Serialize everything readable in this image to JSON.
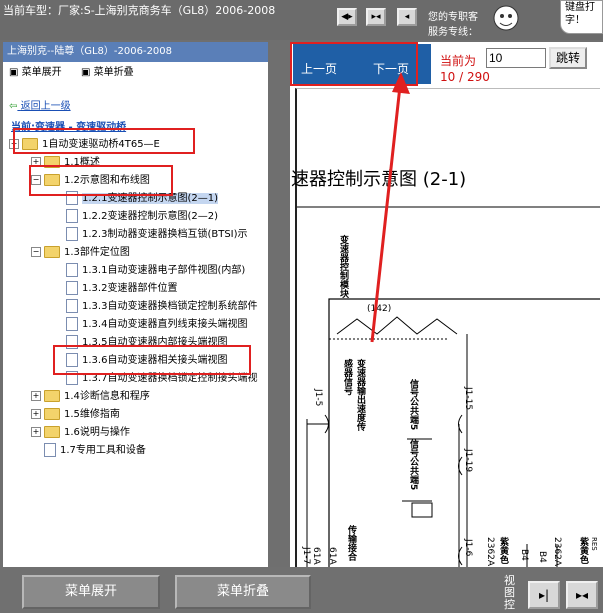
{
  "header": {
    "car_title": "当前车型：厂家:S-上海别克商务车（GL8）2006-2008",
    "help_line1": "您的专职客",
    "help_line2": "服务专线：",
    "bubble_line1": "键盘打",
    "bubble_line2": "字！",
    "nav_icons": [
      "prev-icon",
      "expand-icon",
      "next-icon"
    ]
  },
  "left": {
    "panel_title": "上海别克--陆尊（GL8）-2006-2008",
    "expand_label": "菜单展开",
    "collapse_label": "菜单折叠",
    "back_label": "返回上一级",
    "current_label": "当前:变速器 - 变速驱动桥",
    "tree": [
      {
        "label": "1自动变速驱动桥4T65—E",
        "level": 0,
        "type": "folder",
        "toggle": "−"
      },
      {
        "label": "1.1概述",
        "level": 1,
        "type": "folder",
        "toggle": "+"
      },
      {
        "label": "1.2示意图和布线图",
        "level": 1,
        "type": "folder",
        "toggle": "−"
      },
      {
        "label": "1.2.1变速器控制示意图(2—1)",
        "level": 2,
        "type": "doc",
        "selected": true
      },
      {
        "label": "1.2.2变速器控制示意图(2—2)",
        "level": 2,
        "type": "doc"
      },
      {
        "label": "1.2.3制动器变速器换档互锁(BTSI)示",
        "level": 2,
        "type": "doc"
      },
      {
        "label": "1.3部件定位图",
        "level": 1,
        "type": "folder",
        "toggle": "−"
      },
      {
        "label": "1.3.1自动变速器电子部件视图(内部)",
        "level": 2,
        "type": "doc"
      },
      {
        "label": "1.3.2变速器部件位置",
        "level": 2,
        "type": "doc"
      },
      {
        "label": "1.3.3自动变速器换档锁定控制系统部件",
        "level": 2,
        "type": "doc"
      },
      {
        "label": "1.3.4自动变速器直列线束接头端视图",
        "level": 2,
        "type": "doc"
      },
      {
        "label": "1.3.5自动变速器内部接头端视图",
        "level": 2,
        "type": "doc"
      },
      {
        "label": "1.3.6自动变速器相关接头端视图",
        "level": 2,
        "type": "doc"
      },
      {
        "label": "1.3.7自动变速器换档锁定控制接头端视",
        "level": 2,
        "type": "doc"
      },
      {
        "label": "1.4诊断信息和程序",
        "level": 1,
        "type": "folder",
        "toggle": "+"
      },
      {
        "label": "1.5维修指南",
        "level": 1,
        "type": "folder",
        "toggle": "+"
      },
      {
        "label": "1.6说明与操作",
        "level": 1,
        "type": "folder",
        "toggle": "+"
      },
      {
        "label": "1.7专用工具和设备",
        "level": 1,
        "type": "doc"
      }
    ]
  },
  "right": {
    "prev_page": "上一页",
    "next_page": "下一页",
    "current_label": "当前为",
    "page_input": "10",
    "page_status": "10 / 290",
    "goto_button": "跳转",
    "doc_title": "速器控制示意图  (2-1)",
    "schematic": {
      "top_label": "变速器控制模块",
      "top_code": "(142)",
      "mid_label": "变速器输出速度传感器信号",
      "sig1": "信号公共端5",
      "sig2": "信号公共端5",
      "c1": "J1-5",
      "c2": "J1-15",
      "c3": "J1-19",
      "c4": "J1-6",
      "c5": "J1-7",
      "w1": "2362A",
      "w2": "2362A",
      "w3": "紫黄色",
      "w4": "紫黄色",
      "b4": "B4",
      "b4b": "B4",
      "side1": "传输接合",
      "side2": "61A",
      "side3": "61A",
      "res": "RES"
    }
  },
  "bottom": {
    "expand_button": "菜单展开",
    "collapse_button": "菜单折叠",
    "view_label1": "视",
    "view_label2": "图",
    "view_label3": "控"
  },
  "colors": {
    "accent_red": "#e02020",
    "nav_blue": "#1f5fa6",
    "page_red": "#d01010"
  }
}
